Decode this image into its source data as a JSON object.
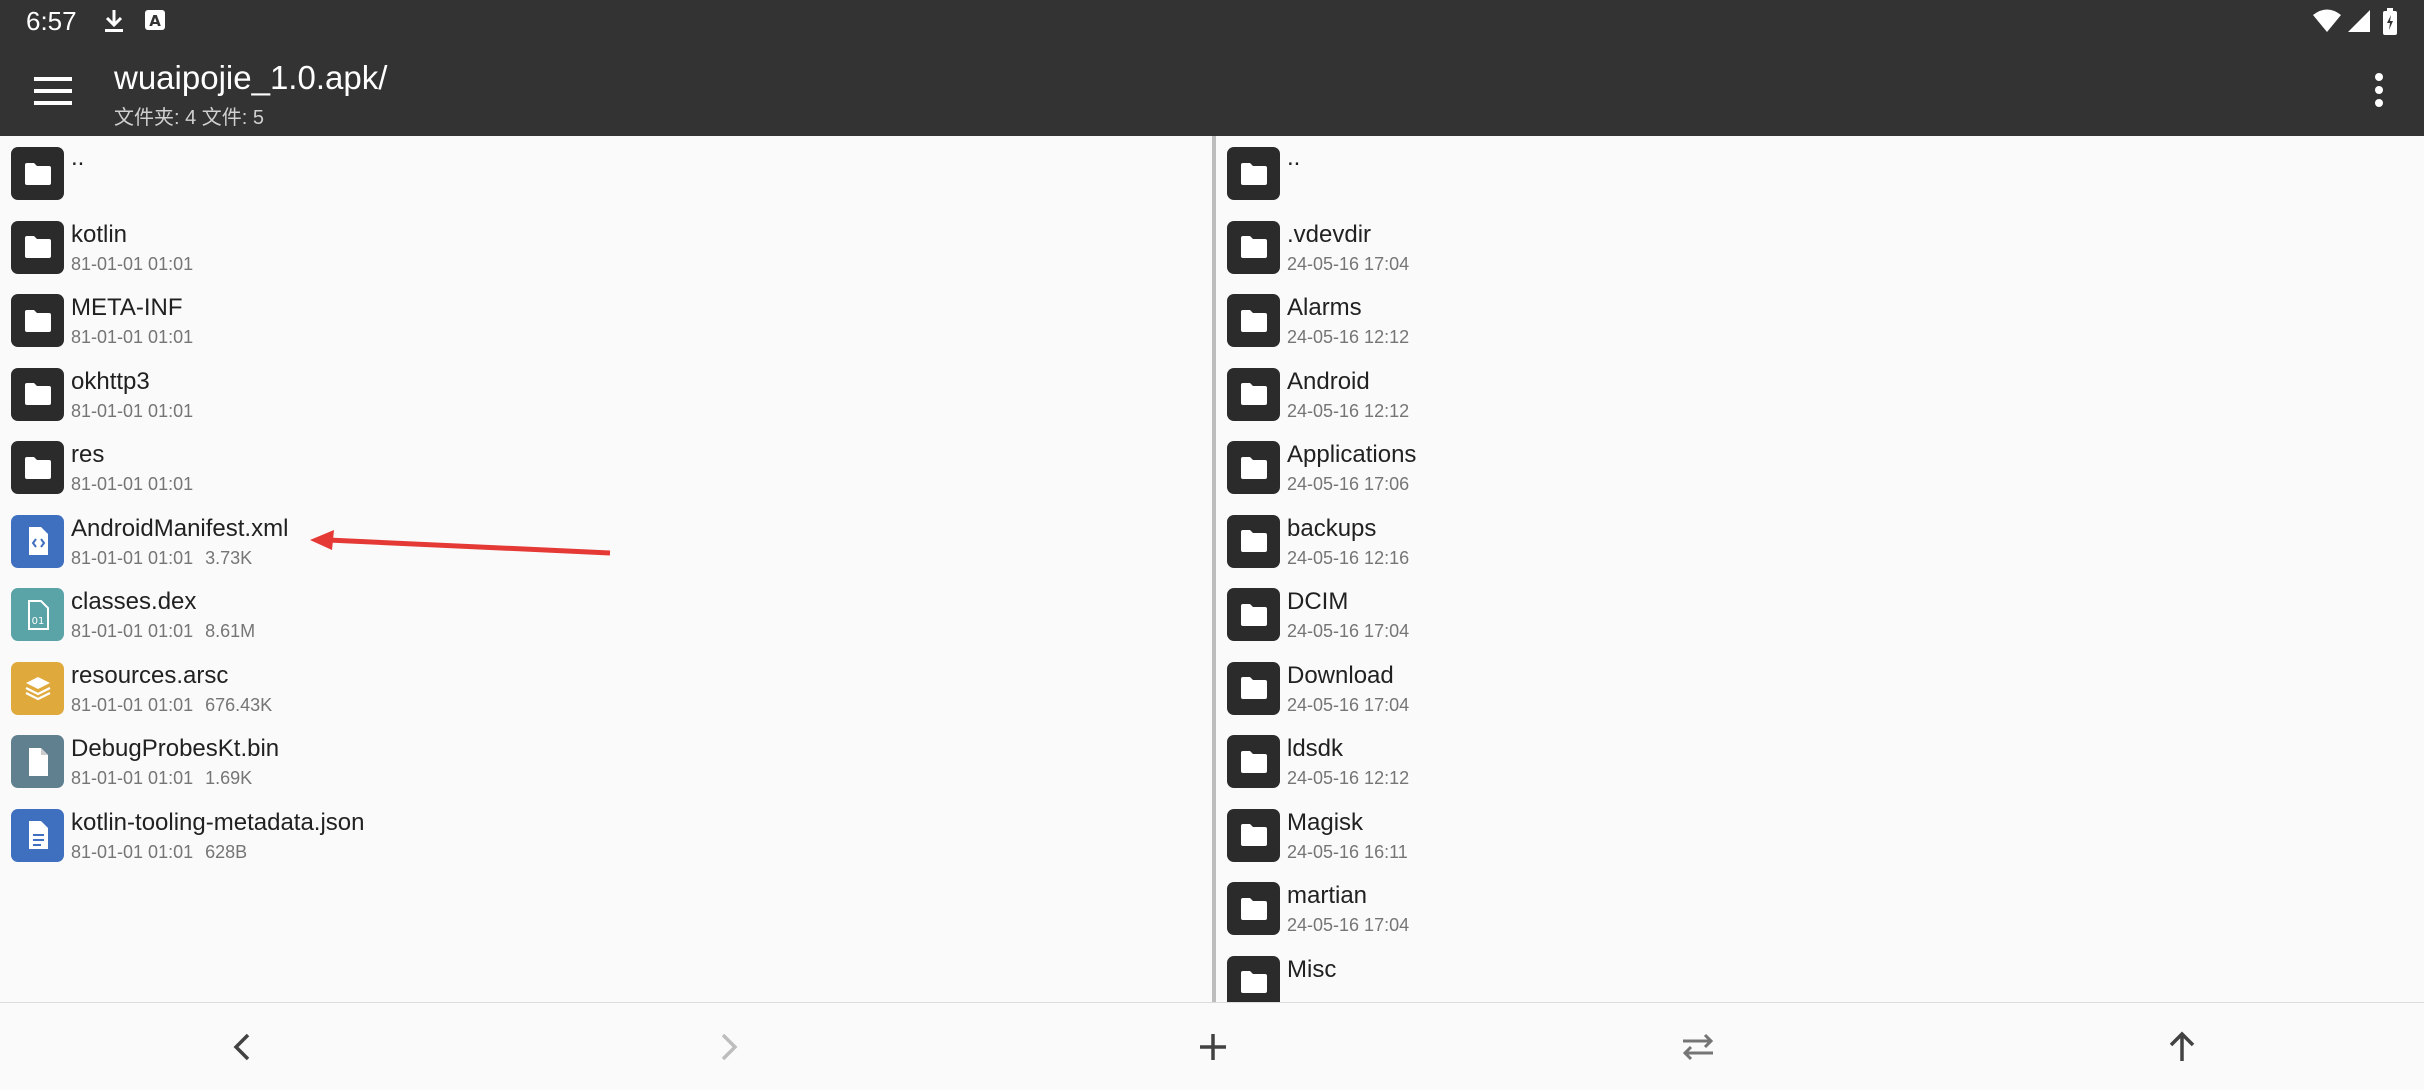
{
  "status_bar": {
    "time": "6:57",
    "left_icons": [
      "download-icon",
      "a-notification-icon"
    ],
    "right_icons": [
      "wifi-icon",
      "signal-icon",
      "battery-icon"
    ]
  },
  "app_bar": {
    "title": "wuaipojie_1.0.apk/",
    "subtitle": "文件夹: 4  文件: 5",
    "menu_icon": "hamburger-menu-icon",
    "more_icon": "more-vert-icon"
  },
  "left_pane": {
    "items": [
      {
        "name": "..",
        "type": "parent",
        "icon": "folder-icon"
      },
      {
        "name": "kotlin",
        "date": "81-01-01 01:01",
        "size": "",
        "icon": "folder-icon"
      },
      {
        "name": "META-INF",
        "date": "81-01-01 01:01",
        "size": "",
        "icon": "folder-icon"
      },
      {
        "name": "okhttp3",
        "date": "81-01-01 01:01",
        "size": "",
        "icon": "folder-icon"
      },
      {
        "name": "res",
        "date": "81-01-01 01:01",
        "size": "",
        "icon": "folder-icon"
      },
      {
        "name": "AndroidManifest.xml",
        "date": "81-01-01 01:01",
        "size": "3.73K",
        "icon": "xml-file-icon"
      },
      {
        "name": "classes.dex",
        "date": "81-01-01 01:01",
        "size": "8.61M",
        "icon": "binary-file-icon"
      },
      {
        "name": "resources.arsc",
        "date": "81-01-01 01:01",
        "size": "676.43K",
        "icon": "layers-file-icon"
      },
      {
        "name": "DebugProbesKt.bin",
        "date": "81-01-01 01:01",
        "size": "1.69K",
        "icon": "generic-file-icon"
      },
      {
        "name": "kotlin-tooling-metadata.json",
        "date": "81-01-01 01:01",
        "size": "628B",
        "icon": "text-file-icon"
      }
    ]
  },
  "right_pane": {
    "items": [
      {
        "name": "..",
        "type": "parent",
        "icon": "folder-icon"
      },
      {
        "name": ".vdevdir",
        "date": "24-05-16 17:04",
        "icon": "folder-icon"
      },
      {
        "name": "Alarms",
        "date": "24-05-16 12:12",
        "icon": "folder-icon"
      },
      {
        "name": "Android",
        "date": "24-05-16 12:12",
        "icon": "folder-icon"
      },
      {
        "name": "Applications",
        "date": "24-05-16 17:06",
        "icon": "folder-icon"
      },
      {
        "name": "backups",
        "date": "24-05-16 12:16",
        "icon": "folder-icon"
      },
      {
        "name": "DCIM",
        "date": "24-05-16 17:04",
        "icon": "folder-icon"
      },
      {
        "name": "Download",
        "date": "24-05-16 17:04",
        "icon": "folder-icon"
      },
      {
        "name": "ldsdk",
        "date": "24-05-16 12:12",
        "icon": "folder-icon"
      },
      {
        "name": "Magisk",
        "date": "24-05-16 16:11",
        "icon": "folder-icon"
      },
      {
        "name": "martian",
        "date": "24-05-16 17:04",
        "icon": "folder-icon"
      },
      {
        "name": "Misc",
        "date": "",
        "icon": "folder-icon"
      }
    ]
  },
  "bottom_bar": {
    "buttons": [
      "back-icon",
      "forward-icon",
      "add-icon",
      "swap-icon",
      "up-icon"
    ]
  },
  "colors": {
    "bar_bg": "#333333",
    "folder_icon_bg": "#2b2b2b",
    "xml_icon_bg": "#3f6fbf",
    "dex_icon_bg": "#5aa3a6",
    "arsc_icon_bg": "#e0a93c",
    "bin_icon_bg": "#60808f",
    "json_icon_bg": "#3f6fbf",
    "annotation_arrow": "#e53935"
  }
}
